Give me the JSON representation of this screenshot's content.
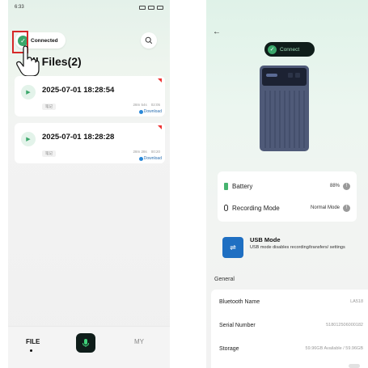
{
  "left_screen": {
    "status_time": "6:33",
    "connection_label": "Connected",
    "files_title": "ll Files(2)",
    "recordings": [
      {
        "datetime": "2025-07-01 18:28:54",
        "tag": "笔记",
        "size": "28m 54s",
        "duration": "02:05",
        "download_label": "Download"
      },
      {
        "datetime": "2025-07-01 18:28:28",
        "tag": "笔记",
        "size": "28m 28s",
        "duration": "00:20",
        "download_label": "Download"
      }
    ],
    "nav": {
      "file_label": "FILE",
      "my_label": "MY"
    }
  },
  "right_screen": {
    "connect_label": "Connect",
    "battery_label": "Battery",
    "battery_value": "88%",
    "recording_mode_label": "Recording Mode",
    "recording_mode_value": "Normal Mode",
    "usb_title": "USB Mode",
    "usb_desc": "USB mode disables recording/transfers/ settings",
    "general_title": "General",
    "bluetooth_name_label": "Bluetooth Name",
    "bluetooth_name_value": "LA518",
    "serial_number_label": "Serial Number",
    "serial_number_value": "518012506000182",
    "storage_label": "Storage",
    "storage_value": "59.96GB Available / 59.96GB"
  },
  "colors": {
    "accent_green": "#3aa76a",
    "highlight_red": "#d62828",
    "usb_blue": "#1f6fc2",
    "download_blue": "#2a6fb0"
  }
}
